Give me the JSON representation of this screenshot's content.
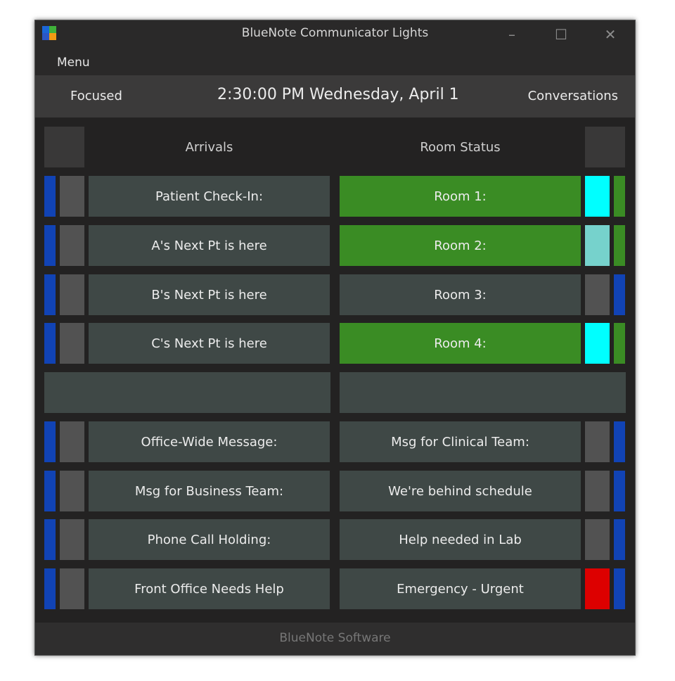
{
  "window": {
    "title": "BlueNote Communicator Lights"
  },
  "window_controls": {
    "minimize": "–",
    "maximize": "☐",
    "close": "✕"
  },
  "menu": {
    "label": "Menu"
  },
  "header": {
    "left": "Focused",
    "clock": "2:30:00 PM  Wednesday, April 1",
    "right": "Conversations"
  },
  "columns": {
    "left": "Arrivals",
    "right": "Room Status"
  },
  "arrivals": [
    "Patient Check-In:",
    "A's Next Pt is here",
    "B's Next Pt is here",
    "C's Next Pt is here"
  ],
  "rooms": [
    {
      "label": "Room 1:",
      "active": true,
      "light_color": "#00ffff",
      "stripe": "green"
    },
    {
      "label": "Room 2:",
      "active": true,
      "light_color": "#76d2cc",
      "stripe": "green"
    },
    {
      "label": "Room 3:",
      "active": false,
      "light_color": "#525252",
      "stripe": "blue"
    },
    {
      "label": "Room 4:",
      "active": true,
      "light_color": "#00ffff",
      "stripe": "green"
    }
  ],
  "messages_left": [
    "Office-Wide Message:",
    "Msg for Business Team:",
    "Phone Call Holding:",
    "Front Office Needs Help"
  ],
  "messages_right": [
    {
      "label": "We're behind schedule",
      "light_color": "#525252"
    },
    {
      "label": "Help needed in Lab",
      "light_color": "#525252"
    },
    {
      "label": "Emergency - Urgent",
      "light_color": "#dd0000"
    }
  ],
  "messages_right_header": {
    "label": "Msg for Clinical Team:",
    "light_color": "#525252"
  },
  "footer": {
    "text": "BlueNote Software"
  },
  "colors": {
    "stripe_blue": "#1143b5",
    "active_green": "#3a8c24",
    "button": "#3f4846",
    "background": "#232222"
  }
}
